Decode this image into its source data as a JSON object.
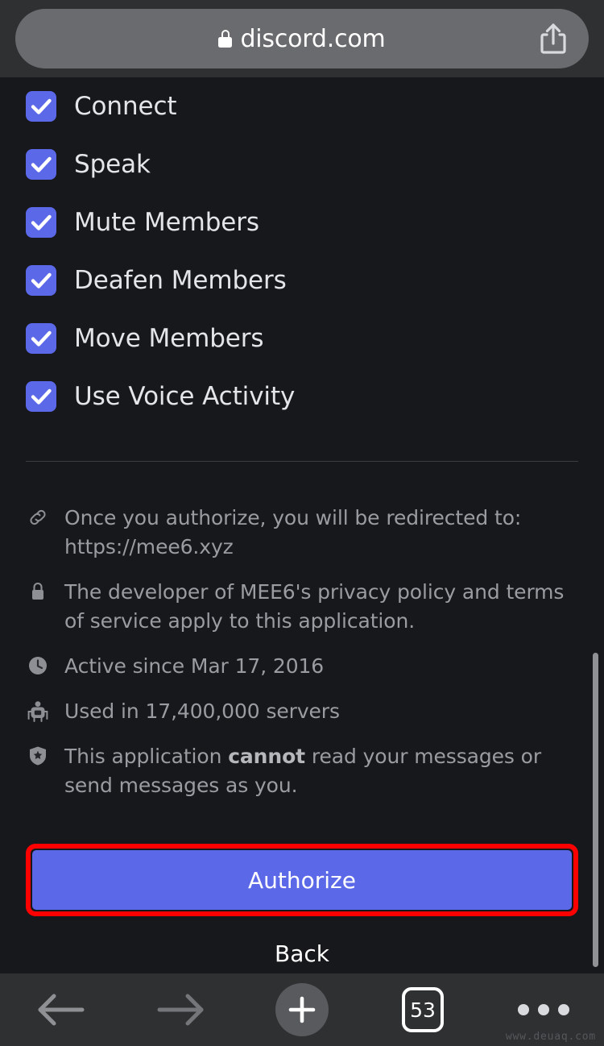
{
  "browser": {
    "url_bar": {
      "url": "discord.com",
      "lock_icon": "lock-icon",
      "share_icon": "share-icon"
    },
    "bottom_toolbar": {
      "back_icon": "arrow-left-icon",
      "forward_icon": "arrow-right-icon",
      "new_tab_icon": "plus-icon",
      "tab_count": "53",
      "more_icon": "ellipsis-icon"
    },
    "watermark": "www.deuaq.com"
  },
  "page": {
    "permissions": [
      {
        "label": "Connect",
        "checked": true
      },
      {
        "label": "Speak",
        "checked": true
      },
      {
        "label": "Mute Members",
        "checked": true
      },
      {
        "label": "Deafen Members",
        "checked": true
      },
      {
        "label": "Move Members",
        "checked": true
      },
      {
        "label": "Use Voice Activity",
        "checked": true
      }
    ],
    "info_rows": [
      {
        "icon": "link-icon",
        "text": "Once you authorize, you will be redirected to: https://mee6.xyz"
      },
      {
        "icon": "lock-icon",
        "text": "The developer of MEE6's privacy policy and terms of service apply to this application."
      },
      {
        "icon": "clock-icon",
        "text": "Active since Mar 17, 2016"
      },
      {
        "icon": "robot-icon",
        "text": "Used in 17,400,000 servers"
      },
      {
        "icon": "shield-star-icon",
        "text_before": "This application ",
        "text_bold": "cannot",
        "text_after": " read your messages or send messages as you."
      }
    ],
    "actions": {
      "authorize_label": "Authorize",
      "back_label": "Back"
    }
  },
  "colors": {
    "blurple": "#5b68e8",
    "highlight_red": "#ff0000",
    "page_background": "#17181b",
    "chrome_background": "#2f3032",
    "muted_text": "#9a9ca1"
  }
}
